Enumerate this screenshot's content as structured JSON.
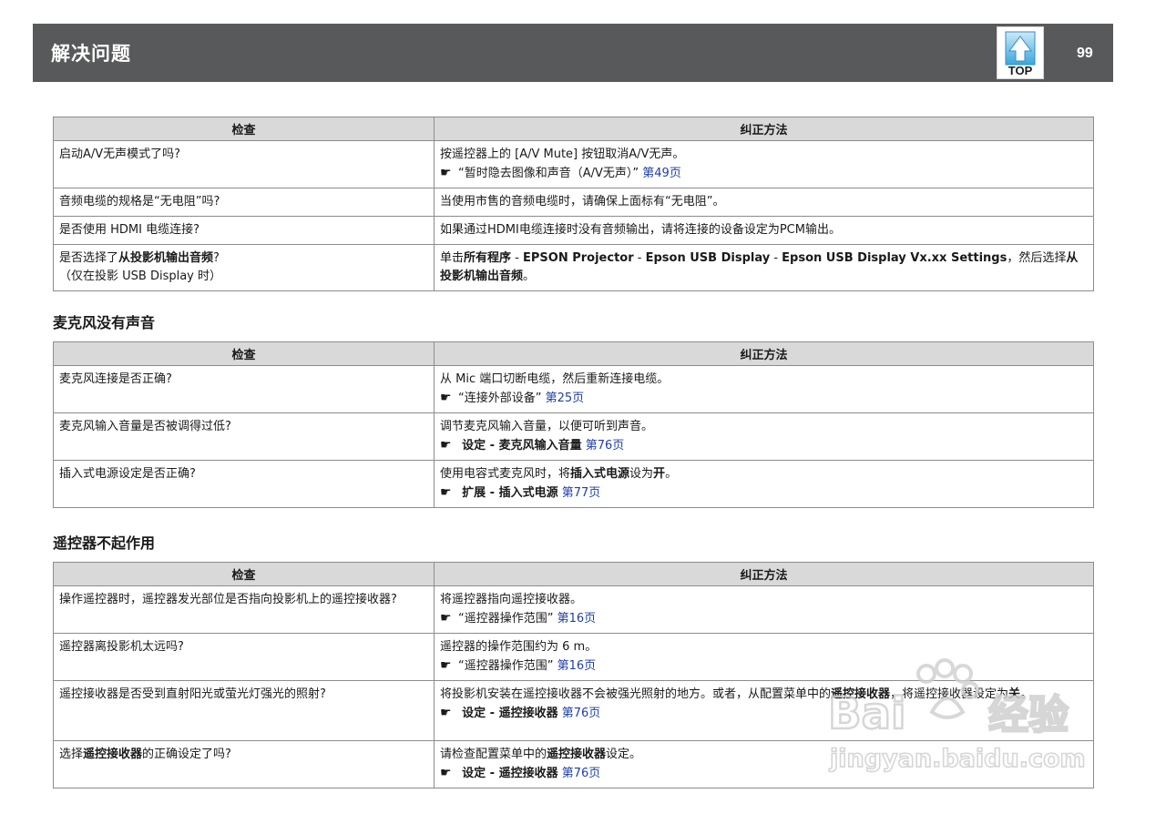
{
  "header": {
    "title": "解决问题",
    "page_number": "99",
    "top_label": "TOP"
  },
  "col_check": "检查",
  "col_fix": "纠正方法",
  "table1": {
    "rows": [
      {
        "check": "启动A/V无声模式了吗?",
        "fix": "按遥控器上的 [A/V Mute] 按钮取消A/V无声。",
        "ref_text": "“暂时隐去图像和声音（A/V无声）”",
        "ref_page": "第49页"
      },
      {
        "check": "音频电缆的规格是“无电阻”吗?",
        "fix": "当使用市售的音频电缆时，请确保上面标有“无电阻”。"
      },
      {
        "check": "是否使用 HDMI 电缆连接?",
        "fix": "如果通过HDMI电缆连接时没有音频输出，请将连接的设备设定为PCM输出。"
      },
      {
        "check_pre": "是否选择了",
        "check_bold": "从投影机输出音频",
        "check_post": "?",
        "check_line2": "（仅在投影 USB Display 时）",
        "fix_pre": "单击",
        "fix_bold1": "所有程序",
        "fix_sep1": " - ",
        "fix_bold2": "EPSON Projector",
        "fix_sep2": " - ",
        "fix_bold3": "Epson USB Display",
        "fix_sep3": " - ",
        "fix_bold4": "Epson USB Display Vx.xx Settings",
        "fix_mid": "，然后选择",
        "fix_bold5": "从投影机输出音频",
        "fix_end": "。"
      }
    ]
  },
  "section2": {
    "title": "麦克风没有声音",
    "rows": [
      {
        "check": "麦克风连接是否正确?",
        "fix": "从 Mic 端口切断电缆，然后重新连接电缆。",
        "ref_text": "“连接外部设备”",
        "ref_page": "第25页"
      },
      {
        "check": "麦克风输入音量是否被调得过低?",
        "fix": "调节麦克风输入音量，以便可听到声音。",
        "ref_bold1": "设定",
        "ref_sep": " - ",
        "ref_bold2": "麦克风输入音量",
        "ref_page": "第76页"
      },
      {
        "check": "插入式电源设定是否正确?",
        "fix_pre": "使用电容式麦克风时，将",
        "fix_bold1": "插入式电源",
        "fix_mid": "设为",
        "fix_bold2": "开",
        "fix_end": "。",
        "ref_bold1": "扩展",
        "ref_sep": " - ",
        "ref_bold2": "插入式电源",
        "ref_page": "第77页"
      }
    ]
  },
  "section3": {
    "title": "遥控器不起作用",
    "rows": [
      {
        "check": "操作遥控器时，遥控器发光部位是否指向投影机上的遥控接收器?",
        "fix": "将遥控器指向遥控接收器。",
        "ref_text": "“遥控器操作范围”",
        "ref_page": "第16页"
      },
      {
        "check": "遥控器离投影机太远吗?",
        "fix": "遥控器的操作范围约为 6 m。",
        "ref_text": "“遥控器操作范围”",
        "ref_page": "第16页"
      },
      {
        "check": "遥控接收器是否受到直射阳光或萤光灯强光的照射?",
        "fix_pre": "将投影机安装在遥控接收器不会被强光照射的地方。或者，从配置菜单中的",
        "fix_bold1": "遥控接收器",
        "fix_mid": "，将遥控接收器设定为",
        "fix_bold2": "关",
        "fix_end": "。",
        "ref_bold1": "设定",
        "ref_sep": " - ",
        "ref_bold2": "遥控接收器",
        "ref_page": "第76页"
      },
      {
        "check_pre": "选择",
        "check_bold": "遥控接收器",
        "check_post": "的正确设定了吗?",
        "fix_pre": "请检查配置菜单中的",
        "fix_bold1": "遥控接收器",
        "fix_end": "设定。",
        "ref_bold1": "设定",
        "ref_sep": " - ",
        "ref_bold2": "遥控接收器",
        "ref_page": "第76页"
      }
    ]
  },
  "watermark": {
    "line1": "Bai 经验",
    "line2": "jingyan.baidu.com"
  },
  "icons": {
    "hand": "pointing-hand-icon",
    "top": "top-arrow-icon"
  },
  "colors": {
    "header_bg": "#58595b",
    "table_header_bg": "#d9d9da",
    "link": "#1f3fa6"
  }
}
